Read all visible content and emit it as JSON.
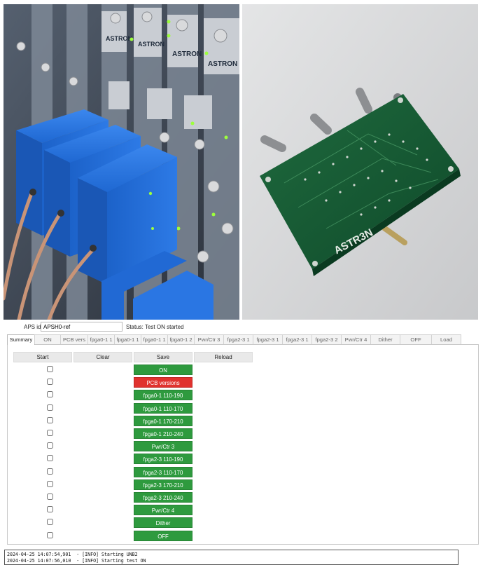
{
  "aps": {
    "label": "APS id",
    "value": "APSH0-ref"
  },
  "status": "Status: Test ON started",
  "tabs": [
    {
      "label": "Summary",
      "width": 40,
      "active": true
    },
    {
      "label": "ON",
      "width": 38
    },
    {
      "label": "PCB vers",
      "width": 40
    },
    {
      "label": "fpga0-1 1",
      "width": 39
    },
    {
      "label": "fpga0-1 1",
      "width": 39
    },
    {
      "label": "fpga0-1 1",
      "width": 39
    },
    {
      "label": "fpga0-1 2",
      "width": 39
    },
    {
      "label": "Pwr/Ctr 3",
      "width": 43
    },
    {
      "label": "fpga2-3 1",
      "width": 43
    },
    {
      "label": "fpga2-3 1",
      "width": 43
    },
    {
      "label": "fpga2-3 1",
      "width": 43
    },
    {
      "label": "fpga2-3 2",
      "width": 43
    },
    {
      "label": "Pwr/Ctr 4",
      "width": 43
    },
    {
      "label": "Dither",
      "width": 43
    },
    {
      "label": "OFF",
      "width": 46
    },
    {
      "label": "Load",
      "width": 43
    }
  ],
  "toolbar": {
    "start": "Start",
    "clear": "Clear",
    "save": "Save",
    "reload": "Reload"
  },
  "tests": [
    {
      "label": "ON",
      "color": "#2e9a3e"
    },
    {
      "label": "PCB versions",
      "color": "#e0322e"
    },
    {
      "label": "fpga0-1 110-190",
      "color": "#2e9a3e"
    },
    {
      "label": "fpga0-1 110-170",
      "color": "#2e9a3e"
    },
    {
      "label": "fpga0-1 170-210",
      "color": "#2e9a3e"
    },
    {
      "label": "fpga0-1 210-240",
      "color": "#2e9a3e"
    },
    {
      "label": "Pwr/Ctr 3",
      "color": "#2e9a3e"
    },
    {
      "label": "fpga2-3 110-190",
      "color": "#2e9a3e"
    },
    {
      "label": "fpga2-3 110-170",
      "color": "#2e9a3e"
    },
    {
      "label": "fpga2-3 170-210",
      "color": "#2e9a3e"
    },
    {
      "label": "fpga2-3 210-240",
      "color": "#2e9a3e"
    },
    {
      "label": "Pwr/Ctr 4",
      "color": "#2e9a3e"
    },
    {
      "label": "Dither",
      "color": "#2e9a3e"
    },
    {
      "label": "OFF",
      "color": "#2e9a3e"
    }
  ],
  "log": [
    "2024-04-25 14:07:54,901  - [INFO] Starting UNB2",
    "2024-04-25 14:07:56,010  - [INFO] Starting test ON"
  ],
  "photos": {
    "left_brand": "ASTRON",
    "right_brand": "ASTR3N"
  }
}
